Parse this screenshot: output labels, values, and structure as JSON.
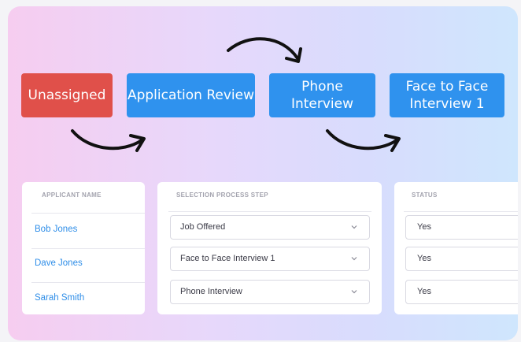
{
  "pipeline": {
    "stages": [
      {
        "label": "Unassigned",
        "color": "#e0504a"
      },
      {
        "label": "Application Review",
        "color": "#2f92ee"
      },
      {
        "label": "Phone Interview",
        "color": "#2f92ee"
      },
      {
        "label": "Face to Face Interview 1",
        "color": "#2f92ee"
      }
    ],
    "arrow_icon": "curved-arrow-icon"
  },
  "table": {
    "columns": {
      "name": "APPLICANT NAME",
      "step": "SELECTION PROCESS STEP",
      "status": "STATUS"
    },
    "rows": [
      {
        "name": "Bob Jones",
        "step": "Job Offered",
        "status": "Yes"
      },
      {
        "name": "Dave Jones",
        "step": "Face to Face Interview 1",
        "status": "Yes"
      },
      {
        "name": "Sarah Smith",
        "step": "Phone Interview",
        "status": "Yes"
      }
    ],
    "select_icon": "chevron-down-icon"
  },
  "colors": {
    "link": "#2f8ee8",
    "stage_blue": "#2f92ee",
    "stage_red": "#e0504a"
  }
}
